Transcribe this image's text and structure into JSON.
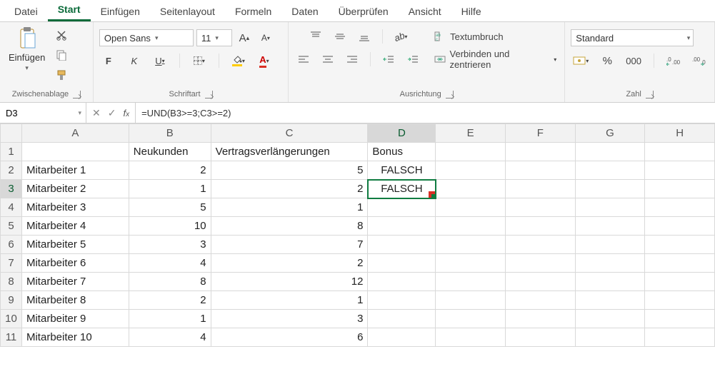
{
  "tabs": [
    "Datei",
    "Start",
    "Einfügen",
    "Seitenlayout",
    "Formeln",
    "Daten",
    "Überprüfen",
    "Ansicht",
    "Hilfe"
  ],
  "active_tab": "Start",
  "ribbon": {
    "clipboard": {
      "paste": "Einfügen",
      "label": "Zwischenablage"
    },
    "font": {
      "name": "Open Sans",
      "size": "11",
      "bold": "F",
      "italic": "K",
      "underline": "U",
      "label": "Schriftart"
    },
    "align": {
      "wrap": "Textumbruch",
      "merge": "Verbinden und zentrieren",
      "label": "Ausrichtung"
    },
    "number": {
      "format": "Standard",
      "thousand": "000",
      "label": "Zahl"
    }
  },
  "namebox": "D3",
  "formula": "=UND(B3>=3;C3>=2)",
  "columns": [
    "A",
    "B",
    "C",
    "D",
    "E",
    "F",
    "G",
    "H"
  ],
  "headers": {
    "B": "Neukunden",
    "C": "Vertragsverlängerungen",
    "D": "Bonus"
  },
  "rows": [
    {
      "n": 1,
      "A": "",
      "B": "",
      "C": "",
      "D": ""
    },
    {
      "n": 2,
      "A": "Mitarbeiter 1",
      "B": "2",
      "C": "5",
      "D": "FALSCH"
    },
    {
      "n": 3,
      "A": "Mitarbeiter 2",
      "B": "1",
      "C": "2",
      "D": "FALSCH"
    },
    {
      "n": 4,
      "A": "Mitarbeiter 3",
      "B": "5",
      "C": "1",
      "D": ""
    },
    {
      "n": 5,
      "A": "Mitarbeiter 4",
      "B": "10",
      "C": "8",
      "D": ""
    },
    {
      "n": 6,
      "A": "Mitarbeiter 5",
      "B": "3",
      "C": "7",
      "D": ""
    },
    {
      "n": 7,
      "A": "Mitarbeiter 6",
      "B": "4",
      "C": "2",
      "D": ""
    },
    {
      "n": 8,
      "A": "Mitarbeiter 7",
      "B": "8",
      "C": "12",
      "D": ""
    },
    {
      "n": 9,
      "A": "Mitarbeiter 8",
      "B": "2",
      "C": "1",
      "D": ""
    },
    {
      "n": 10,
      "A": "Mitarbeiter 9",
      "B": "1",
      "C": "3",
      "D": ""
    },
    {
      "n": 11,
      "A": "Mitarbeiter 10",
      "B": "4",
      "C": "6",
      "D": ""
    }
  ],
  "selected": {
    "row": 3,
    "col": "D"
  }
}
